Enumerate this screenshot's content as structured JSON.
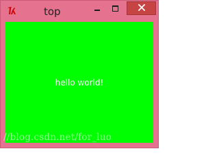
{
  "window": {
    "title": "top",
    "icon": "tk-feather-icon",
    "controls": {
      "minimize_icon": "minimize-icon",
      "maximize_icon": "maximize-icon",
      "close_icon": "close-icon"
    }
  },
  "content": {
    "label": "hello world!",
    "background": "#00ff00",
    "label_color": "#ffffff"
  },
  "watermark": "//blog.csdn.net/for_luo",
  "colors": {
    "frame": "#e5738f",
    "close_button": "#c74444"
  }
}
